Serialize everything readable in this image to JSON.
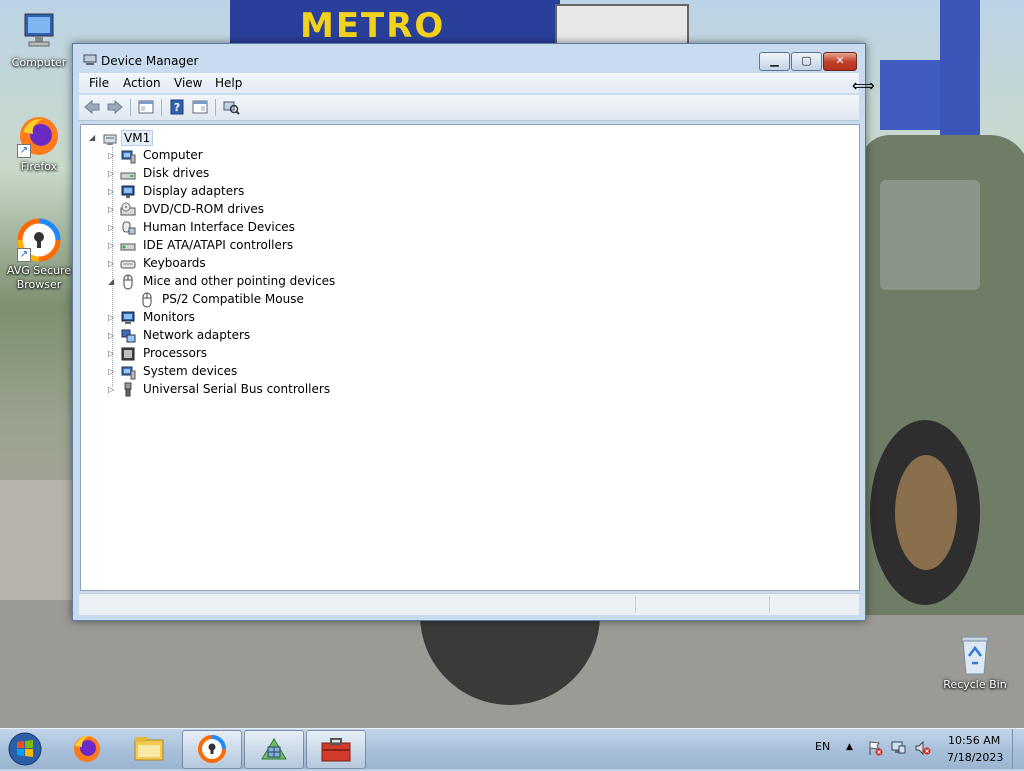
{
  "desktop": {
    "icons": [
      {
        "label": "Computer"
      },
      {
        "label": "Firefox"
      },
      {
        "label": "AVG Secure Browser"
      },
      {
        "label": "Recycle Bin"
      }
    ]
  },
  "window": {
    "title": "Device Manager",
    "menu": [
      "File",
      "Action",
      "View",
      "Help"
    ],
    "tree": {
      "root": "VM1",
      "items": [
        {
          "label": "Computer",
          "icon": "computer-icon",
          "expanded": false
        },
        {
          "label": "Disk drives",
          "icon": "disk-drive-icon",
          "expanded": false
        },
        {
          "label": "Display adapters",
          "icon": "display-adapter-icon",
          "expanded": false
        },
        {
          "label": "DVD/CD-ROM drives",
          "icon": "dvd-drive-icon",
          "expanded": false
        },
        {
          "label": "Human Interface Devices",
          "icon": "hid-icon",
          "expanded": false
        },
        {
          "label": "IDE ATA/ATAPI controllers",
          "icon": "ide-controller-icon",
          "expanded": false
        },
        {
          "label": "Keyboards",
          "icon": "keyboard-icon",
          "expanded": false
        },
        {
          "label": "Mice and other pointing devices",
          "icon": "mouse-icon",
          "expanded": true,
          "children": [
            {
              "label": "PS/2 Compatible Mouse",
              "icon": "mouse-icon"
            }
          ]
        },
        {
          "label": "Monitors",
          "icon": "monitor-icon",
          "expanded": false
        },
        {
          "label": "Network adapters",
          "icon": "network-adapter-icon",
          "expanded": false
        },
        {
          "label": "Processors",
          "icon": "processor-icon",
          "expanded": false
        },
        {
          "label": "System devices",
          "icon": "system-device-icon",
          "expanded": false
        },
        {
          "label": "Universal Serial Bus controllers",
          "icon": "usb-icon",
          "expanded": false
        }
      ]
    }
  },
  "taskbar": {
    "apps": [
      "firefox-icon",
      "file-explorer-icon",
      "avg-browser-icon",
      "network-app-icon",
      "toolbox-app-icon"
    ],
    "tray": {
      "language": "EN",
      "time": "10:56 AM",
      "date": "7/18/2023"
    }
  },
  "colors": {
    "window_frame": "#c9dcef",
    "close_button": "#c2412a",
    "taskbar": "#a9c1db"
  }
}
